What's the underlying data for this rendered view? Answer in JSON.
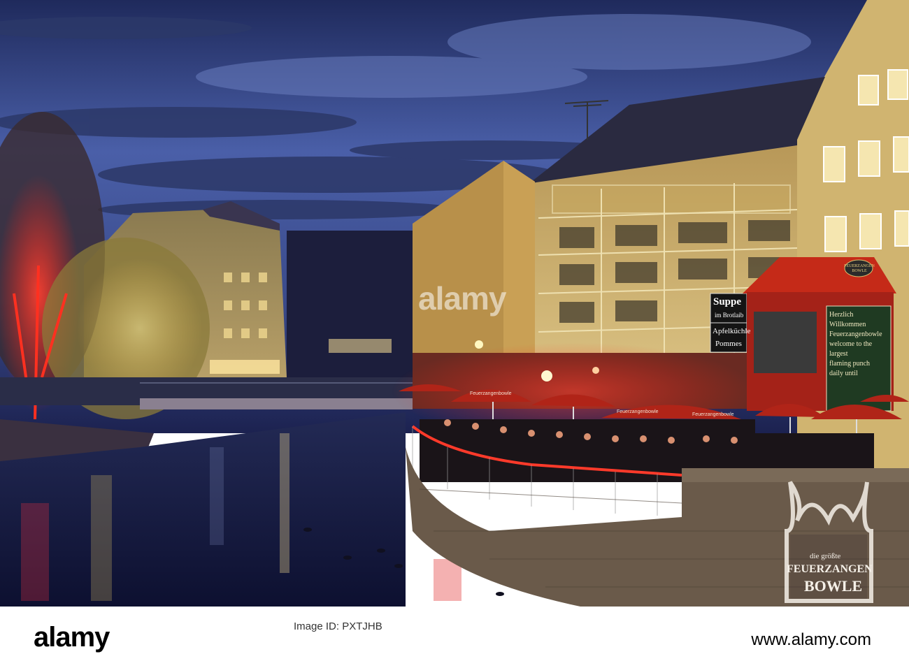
{
  "watermark": {
    "center_logo": "alamy"
  },
  "signs": {
    "suppe": "Suppe",
    "suppe_sub": "im Brotlaib",
    "apfelkuechle": "Apfelküchle",
    "pommes": "Pommes",
    "booth_top": "FEUERZANGEN BOWLE",
    "board_lines": [
      "Herzlich Willkommen",
      "Feuerzangenbowle",
      "welcome to the largest",
      "flaming punch",
      "daily until"
    ],
    "umbrella": "Feuerzangenbowle",
    "projection_line1": "die größte",
    "projection_line2": "FEUERZANGEN",
    "projection_line3": "BOWLE"
  },
  "footer": {
    "logo": "alamy",
    "image_id_label": "Image ID: PXTJHB",
    "image_id": "",
    "url": "www.alamy.com"
  },
  "colors": {
    "sky_top": "#2a3366",
    "sky_mid": "#4a5a9a",
    "water": "#14183a",
    "lights_red": "#e02020",
    "building_yellow": "#c9b070"
  }
}
